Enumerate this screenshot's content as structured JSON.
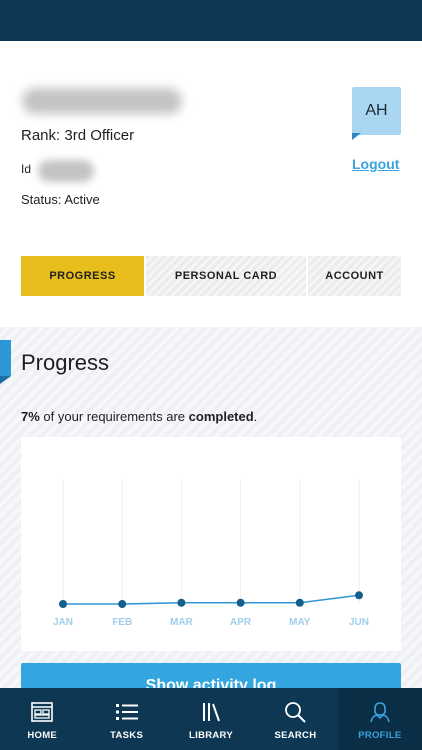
{
  "profile": {
    "rank_label": "Rank: 3rd Officer",
    "id_label": "Id",
    "status_label": "Status: ",
    "status_value": "Active",
    "avatar_initials": "AH",
    "logout_label": "Logout"
  },
  "tabs": [
    {
      "label": "PROGRESS",
      "active": true
    },
    {
      "label": "PERSONAL CARD",
      "active": false
    },
    {
      "label": "ACCOUNT",
      "active": false
    }
  ],
  "progress": {
    "title": "Progress",
    "percent_text": "7%",
    "middle_text": " of your requirements are ",
    "completed_text": "completed",
    "end_text": "."
  },
  "chart_data": {
    "type": "line",
    "categories": [
      "JAN",
      "FEB",
      "MAR",
      "APR",
      "MAY",
      "JUN"
    ],
    "series": [
      {
        "values": [
          0,
          0,
          1,
          1,
          1,
          7
        ]
      }
    ],
    "ylim": [
      0,
      100
    ],
    "grid": "vertical",
    "color": "#2f97d6"
  },
  "activity_button": {
    "label": "Show activity log"
  },
  "nav": [
    {
      "label": "HOME",
      "icon": "home-grid-icon",
      "active": false
    },
    {
      "label": "TASKS",
      "icon": "list-icon",
      "active": false
    },
    {
      "label": "LIBRARY",
      "icon": "library-icon",
      "active": false
    },
    {
      "label": "SEARCH",
      "icon": "search-icon",
      "active": false
    },
    {
      "label": "PROFILE",
      "icon": "person-icon",
      "active": true
    }
  ],
  "colors": {
    "header": "#0d3752",
    "accent": "#33a5df",
    "active_tab": "#e8be1c"
  }
}
